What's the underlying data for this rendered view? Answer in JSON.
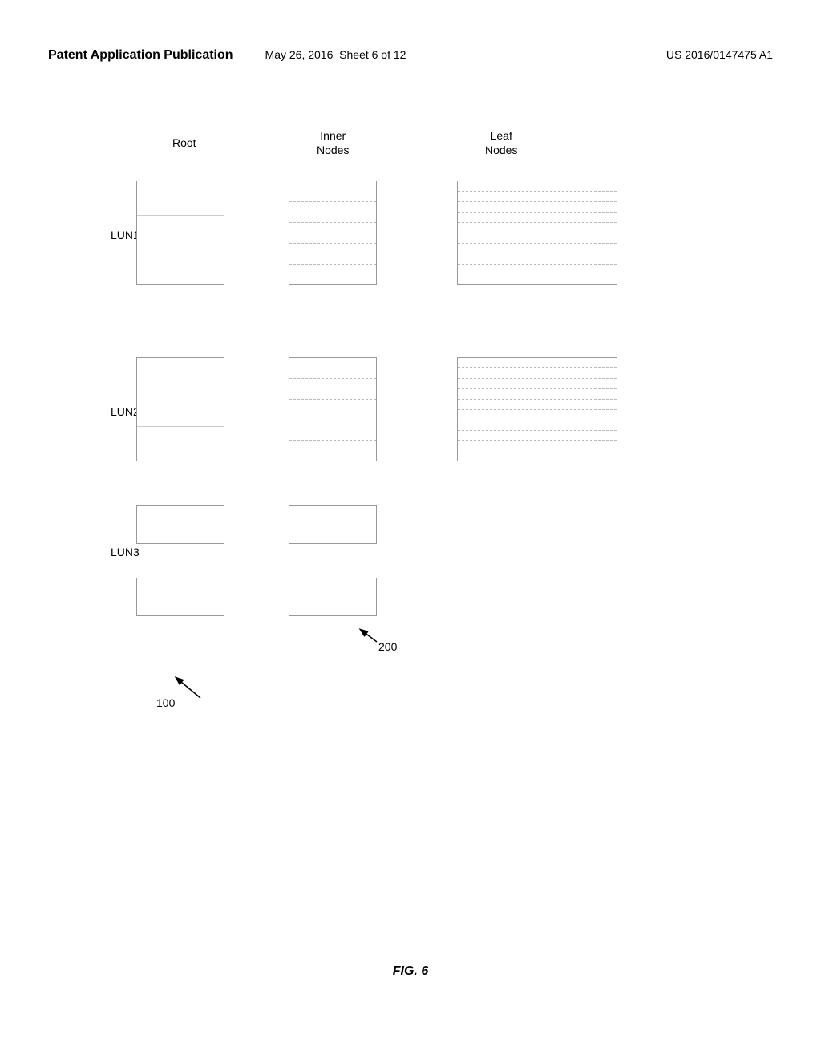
{
  "header": {
    "title": "Patent Application Publication",
    "date": "May 26, 2016",
    "sheet": "Sheet 6 of 12",
    "patent": "US 2016/0147475 A1"
  },
  "diagram": {
    "columns": {
      "root_label": "Root",
      "inner_label": "Inner\nNodes",
      "leaf_label": "Leaf\nNodes"
    },
    "luns": [
      "LUN1",
      "LUN2",
      "LUN3"
    ],
    "ref100": "100",
    "ref200": "200"
  },
  "figure": {
    "caption": "FIG. 6"
  }
}
